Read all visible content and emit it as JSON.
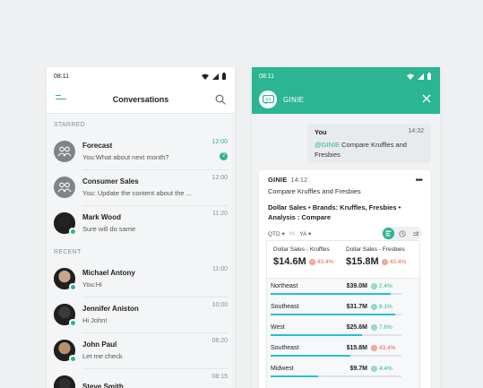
{
  "left": {
    "status_time": "08:11",
    "title": "Conversations",
    "starred_label": "STARRED",
    "recent_label": "RECENT",
    "starred": [
      {
        "name": "Forecast",
        "message": "You:What about next month?",
        "time": "12:00",
        "time_accent": true,
        "unread": "2",
        "avatar": "group"
      },
      {
        "name": "Consumer Sales",
        "message": "You: Update the content about the ...",
        "time": "12:00",
        "avatar": "group"
      },
      {
        "name": "Mark Wood",
        "message": "Sure will do same",
        "time": "11:20",
        "avatar": "person",
        "online": true
      }
    ],
    "recent": [
      {
        "name": "Michael Antony",
        "message": "You:Hi",
        "time": "11:00",
        "avatar": "person",
        "online": true
      },
      {
        "name": "Jennifer Aniston",
        "message": "Hi John!",
        "time": "10:00",
        "avatar": "person",
        "online": true
      },
      {
        "name": "John Paul",
        "message": "Let me check",
        "time": "08:20",
        "avatar": "person",
        "online": true
      },
      {
        "name": "Steve Smith",
        "message": "",
        "time": "08:15",
        "avatar": "person"
      }
    ]
  },
  "right": {
    "status_time": "08:11",
    "bot_name": "GINIE",
    "you_name": "You",
    "you_time": "14:32",
    "you_mention": "@GINIE",
    "you_text": " Compare Kruffles and Fresbies",
    "reply_name": "GINIE",
    "reply_time": "14:12",
    "reply_sub": "Compare Kruffles and Fresbies",
    "reply_title": "Dollar Sales • Brands: Kruffles, Fresbies • Analysis : Compare",
    "period": "QTD",
    "vs": "vs",
    "compare_period": "YA",
    "kpis": [
      {
        "label": "Dollar Sales - Kruffles",
        "value": "$14.6M",
        "delta": "43.4%",
        "dir": "down"
      },
      {
        "label": "Dollar Sales - Fresbies",
        "value": "$15.8M",
        "delta": "43.4%",
        "dir": "down"
      }
    ],
    "regions": [
      {
        "name": "Northeast",
        "value": "$39.0M",
        "delta": "2.4%",
        "dir": "up",
        "fill": 0.92
      },
      {
        "name": "Southeast",
        "value": "$31.7M",
        "delta": "8.1%",
        "dir": "up",
        "fill": 0.95
      },
      {
        "name": "West",
        "value": "$25.6M",
        "delta": "7.6%",
        "dir": "up",
        "fill": 0.7
      },
      {
        "name": "Southeast",
        "value": "$15.8M",
        "delta": "43.4%",
        "dir": "down",
        "fill": 0.61
      },
      {
        "name": "Midwest",
        "value": "$9.7M",
        "delta": "4.4%",
        "dir": "up",
        "fill": 0.36
      }
    ]
  },
  "colors": {
    "accent": "#2bb592",
    "bar": "#25c0d8",
    "down": "#e5604b"
  }
}
